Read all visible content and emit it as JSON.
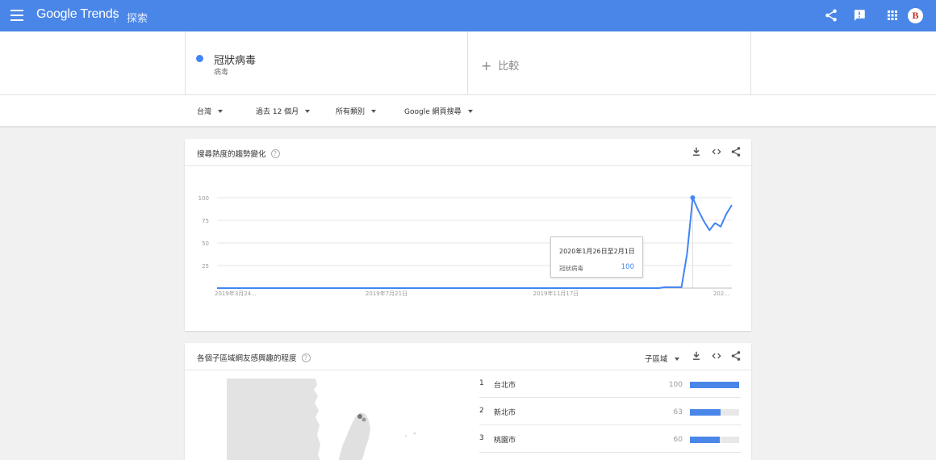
{
  "header": {
    "logo_text": "Google Trends",
    "explore_label": "探索",
    "icons": [
      "menu-icon",
      "share-icon",
      "feedback-icon",
      "apps-icon"
    ],
    "avatar_letter": "B",
    "accent_color": "#4a86e8"
  },
  "search": {
    "term": "冠狀病毒",
    "term_subtitle": "病毒",
    "term_color": "#4285f4",
    "compare_label": "比較"
  },
  "filters": {
    "region": "台灣",
    "time": "過去 12 個月",
    "category": "所有類別",
    "property": "Google 網頁搜尋"
  },
  "interest_over_time": {
    "title": "搜尋熱度的趨勢變化",
    "icons": [
      "download-icon",
      "embed-icon",
      "share-icon"
    ],
    "tooltip": {
      "date": "2020年1月26日至2月1日",
      "term": "冠狀病毒",
      "value": "100"
    }
  },
  "chart_data": {
    "type": "line",
    "series": [
      {
        "name": "冠狀病毒",
        "color": "#4285f4",
        "values": [
          0,
          0,
          0,
          0,
          0,
          0,
          0,
          0,
          0,
          0,
          0,
          0,
          0,
          0,
          0,
          0,
          0,
          0,
          0,
          0,
          0,
          0,
          0,
          0,
          0,
          0,
          0,
          0,
          0,
          0,
          0,
          0,
          0,
          0,
          0,
          0,
          0,
          0,
          0,
          0,
          0,
          0,
          0,
          0,
          0,
          0,
          0,
          0,
          0,
          0,
          0,
          0,
          0,
          0,
          0,
          0,
          0,
          0,
          0,
          0,
          0,
          0,
          0,
          0,
          0,
          0,
          0,
          0,
          0,
          0,
          0,
          0,
          0,
          0,
          0,
          0,
          0,
          0,
          0,
          0,
          1,
          1,
          1,
          1,
          38,
          100,
          86,
          74,
          64,
          72,
          68,
          82,
          92
        ]
      }
    ],
    "x_tick_labels": [
      "2019年3月24...",
      "2019年7月21日",
      "2019年11月17日",
      "202..."
    ],
    "y_ticks": [
      25,
      50,
      75,
      100
    ],
    "ylim": [
      0,
      100
    ],
    "highlight_index": 85,
    "grid": true
  },
  "interest_by_region": {
    "title": "各個子區域網友感興趣的程度",
    "resolution_label": "子區域",
    "icons": [
      "download-icon",
      "embed-icon",
      "share-icon"
    ],
    "regions": [
      {
        "rank": "1",
        "name": "台北市",
        "value": "100",
        "level": 100
      },
      {
        "rank": "2",
        "name": "新北市",
        "value": "63",
        "level": 63
      },
      {
        "rank": "3",
        "name": "桃園市",
        "value": "60",
        "level": 60
      }
    ]
  }
}
